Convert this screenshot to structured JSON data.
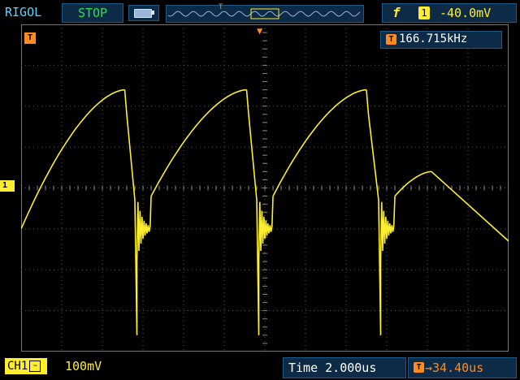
{
  "header": {
    "brand": "RIGOL",
    "run_state": "STOP",
    "mem_trigger_marker": "T",
    "trigger": {
      "edge_icon": "rising-edge-icon",
      "edge_glyph": "f",
      "source": "1",
      "level": "-40.0mV"
    }
  },
  "screen": {
    "trigger_position_marker": "▼",
    "trigger_marker_label": "T",
    "channel_marker_label": "1",
    "frequency_icon": "T",
    "frequency": "166.715kHz"
  },
  "footer": {
    "channel_label": "CH1",
    "coupling": "~",
    "volts_per_div": "100mV",
    "timebase_label": "Time 2.000us",
    "offset_icon": "T",
    "offset": "→34.40us"
  },
  "colors": {
    "trace": "#ffee2e",
    "grid": "#555555",
    "accent_orange": "#ff8a1e",
    "accent_green": "#2ee04b",
    "panel": "#0d2a46"
  },
  "chart_data": {
    "type": "line",
    "title": "",
    "xlabel": "",
    "ylabel": "",
    "x_divisions": 12,
    "y_divisions": 8,
    "x": [
      0,
      1,
      2,
      3,
      4,
      5,
      6,
      7,
      8,
      9,
      10,
      11,
      12
    ],
    "series": [
      {
        "values": [
          -1.6,
          1.2,
          2.7,
          0.6,
          0.5,
          2.6,
          0.55,
          0.4,
          2.4,
          0.6,
          0.4,
          2.5,
          -1.4
        ]
      }
    ]
  }
}
